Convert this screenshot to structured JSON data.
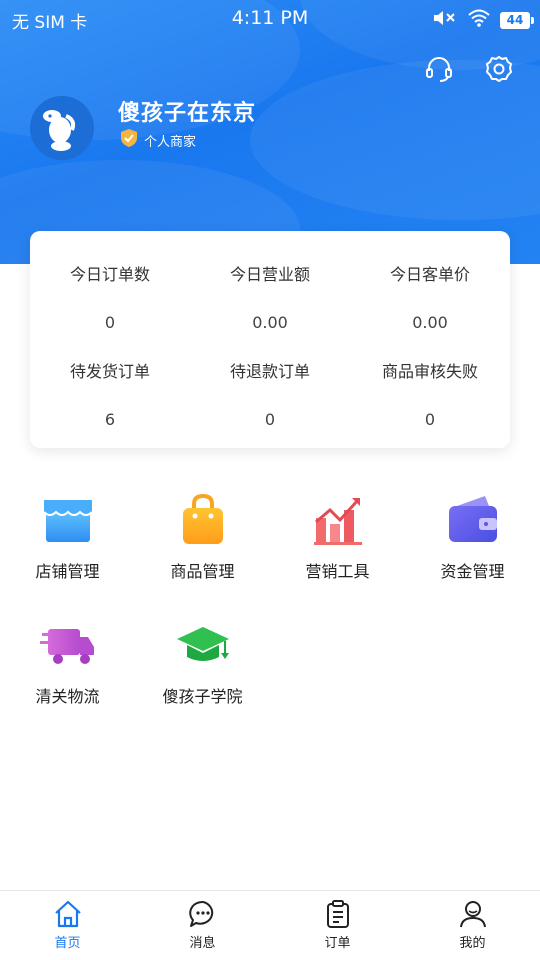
{
  "status_bar": {
    "carrier": "无 SIM 卡",
    "time": "4:11 PM",
    "battery": "44"
  },
  "profile": {
    "store_name": "傻孩子在东京",
    "badge": "个人商家"
  },
  "stats": [
    {
      "label": "今日订单数",
      "value": "0"
    },
    {
      "label": "今日营业额",
      "value": "0.00"
    },
    {
      "label": "今日客单价",
      "value": "0.00"
    },
    {
      "label": "待发货订单",
      "value": "6"
    },
    {
      "label": "待退款订单",
      "value": "0"
    },
    {
      "label": "商品审核失败",
      "value": "0"
    }
  ],
  "menu": [
    {
      "label": "店铺管理",
      "icon": "store-icon"
    },
    {
      "label": "商品管理",
      "icon": "shopping-bag-icon"
    },
    {
      "label": "营销工具",
      "icon": "marketing-chart-icon"
    },
    {
      "label": "资金管理",
      "icon": "wallet-icon"
    },
    {
      "label": "清关物流",
      "icon": "truck-icon"
    },
    {
      "label": "傻孩子学院",
      "icon": "graduation-cap-icon"
    }
  ],
  "tabs": [
    {
      "label": "首页",
      "icon": "home-icon"
    },
    {
      "label": "消息",
      "icon": "chat-icon"
    },
    {
      "label": "订单",
      "icon": "clipboard-icon"
    },
    {
      "label": "我的",
      "icon": "user-icon"
    }
  ],
  "colors": {
    "primary": "#1a78ef",
    "card_bg": "#ffffff"
  }
}
